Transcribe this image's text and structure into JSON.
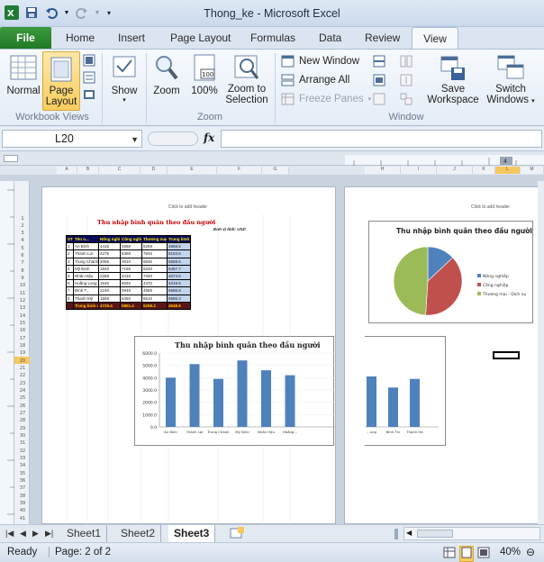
{
  "window": {
    "title": "Thong_ke  -  Microsoft Excel"
  },
  "tabs": [
    "File",
    "Home",
    "Insert",
    "Page Layout",
    "Formulas",
    "Data",
    "Review",
    "View"
  ],
  "ribbon": {
    "normal": "Normal",
    "page_layout_line1": "Page",
    "page_layout_line2": "Layout",
    "show": "Show",
    "zoom": "Zoom",
    "zoom100": "100%",
    "zoom_sel_line1": "Zoom to",
    "zoom_sel_line2": "Selection",
    "new_window": "New Window",
    "arrange_all": "Arrange All",
    "freeze_panes": "Freeze Panes",
    "save_ws_line1": "Save",
    "save_ws_line2": "Workspace",
    "switch_line1": "Switch",
    "switch_line2": "Windows",
    "group_workbook_views": "Workbook Views",
    "group_zoom": "Zoom",
    "group_window": "Window"
  },
  "formula_bar": {
    "name_box": "L20",
    "fx": "fx",
    "value": ""
  },
  "columns_left": [
    "A",
    "B",
    "C",
    "D",
    "E",
    "F",
    "G"
  ],
  "columns_right": [
    "H",
    "I",
    "J",
    "K",
    "L",
    "M"
  ],
  "page_header_left": "Click to add header",
  "page_header_right": "Click to add header",
  "sheet": {
    "title": "Thu nhập bình quân theo đầu người",
    "unit": "Đơn vị tính: USD",
    "header": [
      "STT",
      "Tên n...",
      "Nông nghiệp",
      "Công nghiệp",
      "Thương mại - Dịch vụ",
      "Trung bình theo..."
    ],
    "rows": [
      [
        "1",
        "An Bình",
        "4415",
        "4568",
        "5259",
        "4868.5"
      ],
      [
        "2",
        "Thành Lợi",
        "4275",
        "6388",
        "7945",
        "5153.5"
      ],
      [
        "3",
        "Trung Chánh",
        "2055",
        "4810",
        "5836",
        "5558.5"
      ],
      [
        "4",
        "Mỹ Định",
        "1840",
        "7155",
        "8220",
        "5457.7"
      ],
      [
        "5",
        "Nhân Hậu",
        "2268",
        "4415",
        "7340",
        "4674.5"
      ],
      [
        "6",
        "Hoằng Long",
        "1640",
        "6545",
        "4470",
        "4218.5"
      ],
      [
        "7",
        "Đinh T...",
        "2240",
        "5948",
        "4955",
        "5585.8"
      ],
      [
        "8",
        "Thạnh Mỹ",
        "1558",
        "5450",
        "6510",
        "5585.3"
      ]
    ],
    "total": [
      "",
      "Trung bình c...",
      "4725.4",
      "5851.4",
      "5258.3",
      "4948.9"
    ]
  },
  "chart_data": [
    {
      "type": "bar",
      "title": "Thu nhập bình quân theo đầu người",
      "categories": [
        "An Bình",
        "Thành Lợi",
        "Trung Chánh",
        "Mỹ Định",
        "Nhân Hậu",
        "Hoằng...",
        "...ung",
        "Bình Tín",
        "Thạnh Hà"
      ],
      "values": [
        4000,
        5100,
        3900,
        5400,
        4600,
        4200,
        4100,
        3200,
        3900
      ],
      "yticks": [
        "6000.0",
        "5000.0",
        "4000.0",
        "3000.0",
        "2000.0",
        "1000.0",
        "0.0"
      ],
      "ylim": [
        0,
        6000
      ]
    },
    {
      "type": "pie",
      "title": "Thu nhập bình quân theo đầu người",
      "categories": [
        "Nông nghiệp",
        "Công nghiệp",
        "Thương mại - Dịch vụ"
      ],
      "values": [
        13,
        38,
        49
      ],
      "colors": [
        "#4f81bd",
        "#c0504d",
        "#9bbb59"
      ]
    }
  ],
  "sheet_tabs": [
    "Sheet1",
    "Sheet2",
    "Sheet3"
  ],
  "active_sheet": "Sheet3",
  "status": {
    "ready": "Ready",
    "page": "Page: 2 of 2",
    "zoom": "40%"
  }
}
